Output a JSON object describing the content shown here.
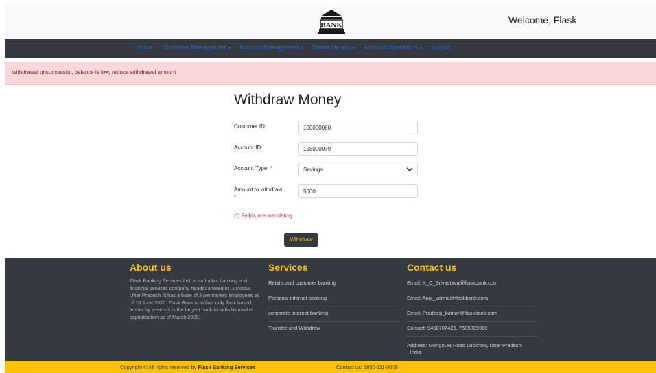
{
  "header": {
    "logo_text": "BANK",
    "welcome": "Welcome, Flask"
  },
  "nav": {
    "items": [
      {
        "label": "Home",
        "dropdown": false
      },
      {
        "label": "Customer Management",
        "dropdown": true
      },
      {
        "label": "Account Management",
        "dropdown": true
      },
      {
        "label": "Status Details",
        "dropdown": true
      },
      {
        "label": "Account Operations",
        "dropdown": true
      },
      {
        "label": "Logout",
        "dropdown": false
      }
    ],
    "caret": "▾"
  },
  "alert": {
    "message": "withdrawal unsuccessful, balance is low, reduce withdrawal amount"
  },
  "form": {
    "title": "Withdraw Money",
    "customer_id": {
      "label": "Customer ID:",
      "value": "100000080"
    },
    "account_id": {
      "label": "Account ID:",
      "value": "158000079"
    },
    "account_type": {
      "label": "Account Type:",
      "required_mark": "*",
      "value": "Savings"
    },
    "amount": {
      "label": "Amount to withdraw:",
      "required_mark": "*",
      "value": "5000"
    },
    "mandatory_note": "(*) Feilds are mendatory",
    "submit_label": "Withdraw"
  },
  "footer": {
    "about": {
      "heading": "About us",
      "text": "Flask Banking Services Ltd. is an Indian banking and financial services company headquartered in Lucknow, Uttar Pradesh. It has a base of 3 permanent employees as of 16 June 2020. Flask Bank is India's only flask based lender by assets.It is the largest bank in India by market capitalisation as of March 2020."
    },
    "services": {
      "heading": "Services",
      "items": [
        "Retails and customer banking",
        "Personal internet banking",
        "corporate internet banking",
        "Transfer and Withdraw"
      ]
    },
    "contact": {
      "heading": "Contact us",
      "items": [
        "Email: K_C_Srivastava@flaskbank.com",
        "Email: Anuj_verma@flaskbank.com",
        "Email: Pradeep_kumar@flaskbank.com",
        "Contact: 9458707426, 7505009960",
        "Address: MongoDB Road Lucknow, Uttar Pradesh - India"
      ]
    }
  },
  "copyright": {
    "prefix": "Copyright © All rights reserved by",
    "brand": "Flask Banking Services",
    "contact": "Contact us: 1800-111-0009"
  },
  "colors": {
    "dark": "#343a40",
    "accent": "#ffc107",
    "link": "#0d6efd",
    "alert_bg": "#f8d7da",
    "required": "#dc3545"
  }
}
